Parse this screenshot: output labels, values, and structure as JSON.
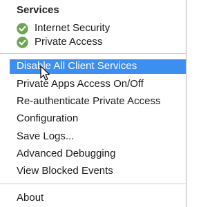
{
  "header": {
    "title": "Services"
  },
  "statuses": [
    {
      "label": "Internet Security",
      "icon": "check-circle-icon",
      "color": "#6aa84f"
    },
    {
      "label": "Private Access",
      "icon": "check-circle-icon",
      "color": "#6aa84f"
    }
  ],
  "menu": {
    "items": [
      {
        "label": "Disable All Client Services",
        "selected": true
      },
      {
        "label": "Private Apps Access On/Off"
      },
      {
        "label": "Re-authenticate Private Access"
      },
      {
        "label": "Configuration"
      },
      {
        "label": "Save Logs..."
      },
      {
        "label": "Advanced Debugging"
      },
      {
        "label": "View Blocked Events"
      }
    ],
    "about_label": "About"
  },
  "colors": {
    "highlight": "#3c8ef0",
    "status_ok": "#6aa84f"
  }
}
